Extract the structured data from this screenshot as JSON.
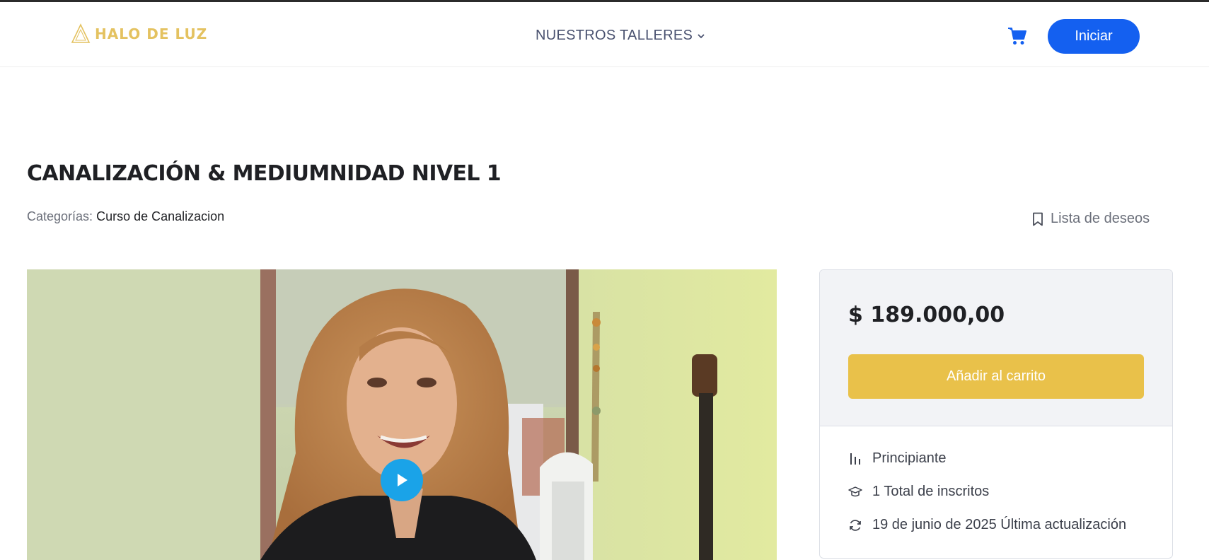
{
  "header": {
    "logo_text": "HALO DE  LUZ",
    "nav_label": "NUESTROS TALLERES",
    "login_label": "Iniciar"
  },
  "course": {
    "title": "CANALIZACIÓN & MEDIUMNIDAD NIVEL 1",
    "categories_label": "Categorías:",
    "category": "Curso de Canalizacion",
    "wishlist_label": "Lista de deseos"
  },
  "sidebar": {
    "price": "$ 189.000,00",
    "add_to_cart_label": "Añadir al carrito",
    "level": "Principiante",
    "enrolled": "1 Total de inscritos",
    "updated": "19 de junio de 2025 Última actualización"
  },
  "colors": {
    "brand_gold": "#e4c260",
    "primary_blue": "#1460f0",
    "cart_button": "#e9c14a",
    "play_button": "#1aa3e8"
  }
}
